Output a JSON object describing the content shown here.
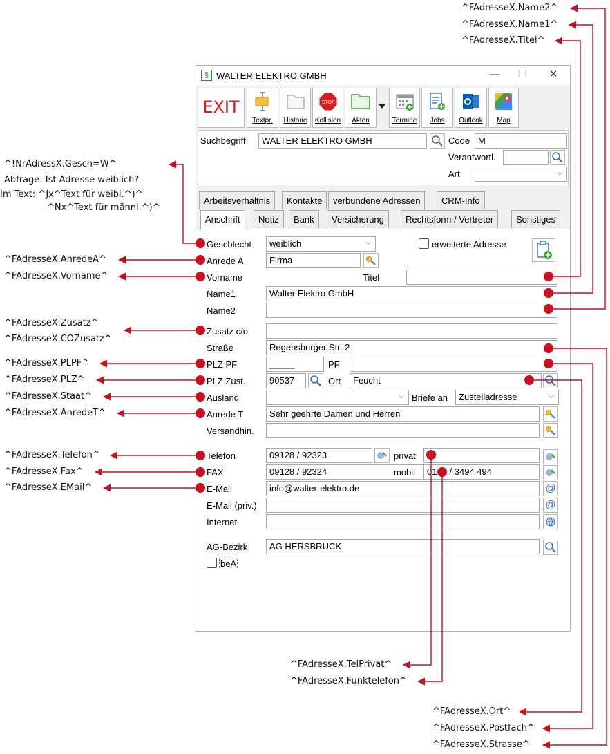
{
  "window": {
    "title": "WALTER ELEKTRO GMBH",
    "minimize": "—",
    "maximize": "☐",
    "close": "✕",
    "app_icon": "§"
  },
  "toolbar": {
    "exit": "EXIT",
    "buttons": [
      {
        "label": "Textpr."
      },
      {
        "label": "Historie"
      },
      {
        "label": "Kollision",
        "badge": "STOP"
      },
      {
        "label": "Akten"
      },
      {
        "label": "Termine"
      },
      {
        "label": "Jobs"
      },
      {
        "label": "Outlook"
      },
      {
        "label": "Map"
      }
    ]
  },
  "header": {
    "suchbegriff_label": "Suchbegriff",
    "suchbegriff_value": "WALTER ELEKTRO GMBH",
    "code_label": "Code",
    "code_value": "M",
    "verantwortl_label": "Verantwortl.",
    "verantwortl_value": "",
    "art_label": "Art",
    "art_value": ""
  },
  "tabs_row1": [
    "Arbeitsverhältnis",
    "Kontakte",
    "verbundene Adressen",
    "CRM-Info"
  ],
  "tabs_row2": [
    "Anschrift",
    "Notiz",
    "Bank",
    "Versicherung",
    "Rechtsform / Vertreter",
    "Sonstiges"
  ],
  "form": {
    "geschlecht_label": "Geschlecht",
    "geschlecht_value": "weiblich",
    "erweitert_label": "erweiterte Adresse",
    "anrede_a_label": "Anrede A",
    "anrede_a_value": "Firma",
    "vorname_label": "Vorname",
    "vorname_value": "",
    "titel_label": "Titel",
    "titel_value": "",
    "name1_label": "Name1",
    "name1_value": "Walter Elektro GmbH",
    "name2_label": "Name2",
    "name2_value": "",
    "zusatz_label": "Zusatz  c/o",
    "zusatz_value": "",
    "strasse_label": "Straße",
    "strasse_value": "Regensburger Str. 2",
    "plzpf_label": "PLZ PF",
    "plzpf_value": "_____",
    "pf_label": "PF",
    "pf_value": "",
    "plz_label": "PLZ Zust.",
    "plz_value": "90537",
    "ort_label": "Ort",
    "ort_value": "Feucht",
    "ausland_label": "Ausland",
    "ausland_value": "",
    "briefe_label": "Briefe an",
    "briefe_value": "Zustelladresse",
    "anrede_t_label": "Anrede T",
    "anrede_t_value": "Sehr geehrte Damen und Herren",
    "versand_label": "Versandhin.",
    "versand_value": "",
    "telefon_label": "Telefon",
    "telefon_value": "09128 / 92323",
    "privat_label": "privat",
    "privat_value": "",
    "fax_label": "FAX",
    "fax_value": "09128 / 92324",
    "mobil_label": "mobil",
    "mobil_value": "0171 / 3494 494",
    "email_label": "E-Mail",
    "email_value": "info@walter-elektro.de",
    "email_priv_label": "E-Mail (priv.)",
    "email_priv_value": "",
    "internet_label": "Internet",
    "internet_value": "",
    "ag_label": "AG-Bezirk",
    "ag_value": "AG HERSBRUCK",
    "bea_label": "beA"
  },
  "annotations": {
    "name2": "^FAdresseX.Name2^",
    "name1": "^FAdresseX.Name1^",
    "titel": "^FAdresseX.Titel^",
    "gesch1": "^!NrAdressX.Gesch=W^",
    "gesch2": "Abfrage: Ist Adresse weiblich?",
    "gesch3": "Im Text: ^Jx^Text für weibl.^)^",
    "gesch4": "^Nx^Text für männl.^)^",
    "anredea": "^FAdresseX.AnredeA^",
    "vorname": "^FAdresseX.Vorname^",
    "zusatz": "^FAdresseX.Zusatz^",
    "cozusatz": "^FAdresseX.COZusatz^",
    "plzpf": "^FAdresseX.PLPF^",
    "plz": "^FAdresseX.PLZ^",
    "staat": "^FAdresseX.Staat^",
    "anredet": "^FAdresseX.AnredeT^",
    "telefon": "^FAdresseX.Telefon^",
    "fax": "^FAdresseX.Fax^",
    "email": "^FAdresseX.EMail^",
    "telprivat": "^FAdresseX.TelPrivat^",
    "funktelefon": "^FAdresseX.Funktelefon^",
    "ort": "^FAdresseX.Ort^",
    "postfach": "^FAdresseX.Postfach^",
    "strasse": "^FAdresseX.Strasse^"
  }
}
